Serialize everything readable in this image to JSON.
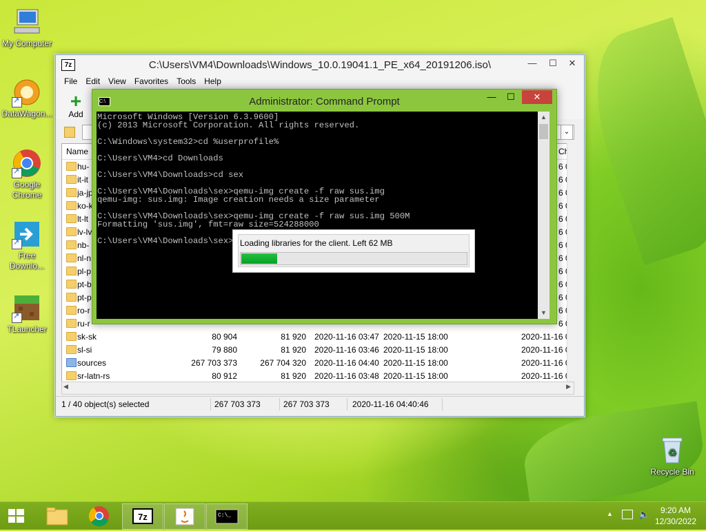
{
  "desktop": {
    "icons": [
      {
        "label": "My Computer"
      },
      {
        "label": "DataWagon..."
      },
      {
        "label": "Google Chrome"
      },
      {
        "label": "Free Downlo..."
      },
      {
        "label": "TLauncher"
      },
      {
        "label": "Recycle Bin"
      }
    ]
  },
  "sevenzip": {
    "title": "C:\\Users\\VM4\\Downloads\\Windows_10.0.19041.1_PE_x64_20191206.iso\\",
    "menu": [
      "File",
      "Edit",
      "View",
      "Favorites",
      "Tools",
      "Help"
    ],
    "toolbar": {
      "add_label": "Add"
    },
    "columns": {
      "name": "Name",
      "last": "Ch"
    },
    "partial_rows": [
      "hu-",
      "it-it",
      "ja-jp",
      "ko-k",
      "lt-lt",
      "lv-lv",
      "nb-",
      "nl-n",
      "pl-p",
      "pt-b",
      "pt-p",
      "ro-r",
      "ru-r"
    ],
    "partial_dates": [
      "6 0",
      "6 0",
      "6 0",
      "6 0",
      "6 0",
      "6 0",
      "6 0",
      "6 0",
      "6 0",
      "6 0",
      "6 0",
      "6 0",
      "6 0"
    ],
    "rows": [
      {
        "name": "sk-sk",
        "size": "80 904",
        "packed": "81 920",
        "modified": "2020-11-16 03:47",
        "created": "2020-11-15 18:00",
        "accessed": "2020-11-16 0"
      },
      {
        "name": "sl-si",
        "size": "79 880",
        "packed": "81 920",
        "modified": "2020-11-16 03:46",
        "created": "2020-11-15 18:00",
        "accessed": "2020-11-16 0"
      },
      {
        "name": "sources",
        "size": "267 703 373",
        "packed": "267 704 320",
        "modified": "2020-11-16 04:40",
        "created": "2020-11-15 18:00",
        "accessed": "2020-11-16 0"
      },
      {
        "name": "sr-latn-rs",
        "size": "80 912",
        "packed": "81 920",
        "modified": "2020-11-16 03:48",
        "created": "2020-11-15 18:00",
        "accessed": "2020-11-16 0"
      }
    ],
    "status": {
      "selection": "1 / 40 object(s) selected",
      "size": "267 703 373",
      "packed": "267 703 373",
      "date": "2020-11-16 04:40:46"
    }
  },
  "cmd": {
    "title": "Administrator:  Command Prompt",
    "lines": [
      "Microsoft Windows [Version 6.3.9600]",
      "(c) 2013 Microsoft Corporation. All rights reserved.",
      "",
      "C:\\Windows\\system32>cd %userprofile%",
      "",
      "C:\\Users\\VM4>cd Downloads",
      "",
      "C:\\Users\\VM4\\Downloads>cd sex",
      "",
      "C:\\Users\\VM4\\Downloads\\sex>qemu-img create -f raw sus.img",
      "qemu-img: sus.img: Image creation needs a size parameter",
      "",
      "C:\\Users\\VM4\\Downloads\\sex>qemu-img create -f raw sus.img 500M",
      "Formatting 'sus.img', fmt=raw size=524288000",
      "",
      "C:\\Users\\VM4\\Downloads\\sex>"
    ]
  },
  "loading": {
    "message": "Loading libraries for the client. Left 62 MB",
    "progress": 0.16
  },
  "taskbar": {
    "time": "9:20 AM",
    "date": "12/30/2022"
  }
}
